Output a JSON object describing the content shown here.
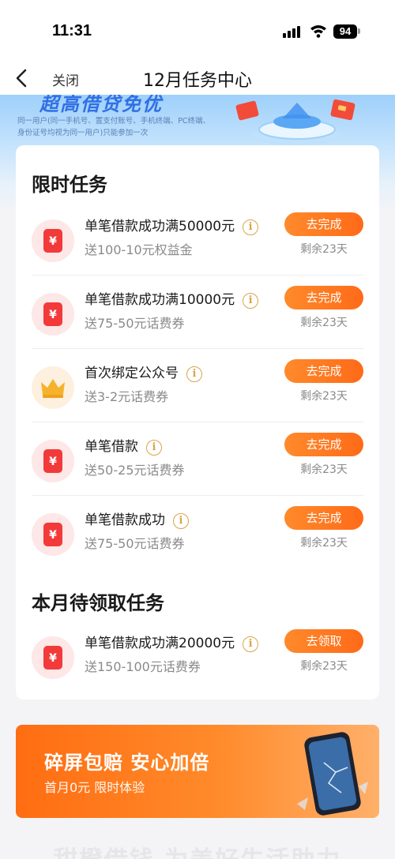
{
  "status_bar": {
    "time": "11:31",
    "battery": "94"
  },
  "nav": {
    "close_label": "关闭",
    "title": "12月任务中心"
  },
  "banner": {
    "headline": "超高借贷免优",
    "note": "同一用户(同一手机号、置支付账号、手机终端、PC终端、身份证号均视为同一用户)只能参加一次"
  },
  "limited_section": {
    "title": "限时任务",
    "tasks": [
      {
        "icon": "red-envelope-icon",
        "name": "单笔借款成功满50000元",
        "reward": "送100-10元权益金",
        "button": "去完成",
        "remaining": "剩余23天"
      },
      {
        "icon": "red-envelope-icon",
        "name": "单笔借款成功满10000元",
        "reward": "送75-50元话费券",
        "button": "去完成",
        "remaining": "剩余23天"
      },
      {
        "icon": "crown-icon",
        "name": "首次绑定公众号",
        "reward": "送3-2元话费券",
        "button": "去完成",
        "remaining": "剩余23天"
      },
      {
        "icon": "red-envelope-icon",
        "name": "单笔借款",
        "reward": "送50-25元话费券",
        "button": "去完成",
        "remaining": "剩余23天"
      },
      {
        "icon": "red-envelope-icon",
        "name": "单笔借款成功",
        "reward": "送75-50元话费券",
        "button": "去完成",
        "remaining": "剩余23天"
      }
    ]
  },
  "monthly_section": {
    "title": "本月待领取任务",
    "tasks": [
      {
        "icon": "red-envelope-icon",
        "name": "单笔借款成功满20000元",
        "reward": "送150-100元话费券",
        "button": "去领取",
        "remaining": "剩余23天"
      }
    ]
  },
  "promo": {
    "title": "碎屏包赔 安心加倍",
    "subtitle": "首月0元 限时体验"
  },
  "bottom_text": "甜橙借钱 为美好生活助力",
  "icon_glyphs": {
    "yuan": "¥",
    "info": "i"
  },
  "colors": {
    "accent_orange": "#ff6a18",
    "icon_red": "#f23a3a",
    "info_gold": "#d9a54a"
  }
}
